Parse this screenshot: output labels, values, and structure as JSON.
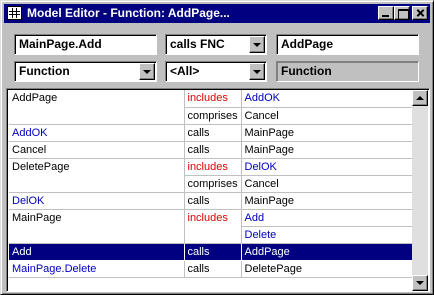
{
  "window": {
    "title": "Model Editor - Function: AddPage...",
    "icon": "model-editor-icon"
  },
  "toolbar": {
    "name_value": "MainPage.Add",
    "relation_value": "calls FNC",
    "target_value": "AddPage",
    "type_value": "Function",
    "filter_value": "<All>",
    "kind_label": "Function"
  },
  "colors": {
    "link_blue": "#0000c0",
    "relation_red": "#e00000",
    "selection": "#000080"
  },
  "rows": [
    {
      "name": "AddPage",
      "name_style": "black",
      "relation": "includes",
      "rel_style": "red",
      "target": "AddOK",
      "target_style": "blue"
    },
    {
      "name": "",
      "name_style": "black",
      "relation": "comprises",
      "rel_style": "black",
      "target": "Cancel",
      "target_style": "black"
    },
    {
      "name": "AddOK",
      "name_style": "blue",
      "relation": "calls",
      "rel_style": "black",
      "target": "MainPage",
      "target_style": "black"
    },
    {
      "name": "Cancel",
      "name_style": "black",
      "relation": "calls",
      "rel_style": "black",
      "target": "MainPage",
      "target_style": "black"
    },
    {
      "name": "DeletePage",
      "name_style": "black",
      "relation": "includes",
      "rel_style": "red",
      "target": "DelOK",
      "target_style": "blue"
    },
    {
      "name": "",
      "name_style": "black",
      "relation": "comprises",
      "rel_style": "black",
      "target": "Cancel",
      "target_style": "black"
    },
    {
      "name": "DelOK",
      "name_style": "blue",
      "relation": "calls",
      "rel_style": "black",
      "target": "MainPage",
      "target_style": "black"
    },
    {
      "name": "MainPage",
      "name_style": "black",
      "relation": "includes",
      "rel_style": "red",
      "target": "Add",
      "target_style": "blue"
    },
    {
      "name": "",
      "name_style": "black",
      "relation": "",
      "rel_style": "black",
      "target": "Delete",
      "target_style": "blue"
    },
    {
      "name": "Add",
      "name_style": "selected",
      "relation": "calls",
      "rel_style": "selected",
      "target": "AddPage",
      "target_style": "selected"
    },
    {
      "name": "MainPage.Delete",
      "name_style": "blue",
      "relation": "calls",
      "rel_style": "black",
      "target": "DeletePage",
      "target_style": "black"
    }
  ]
}
